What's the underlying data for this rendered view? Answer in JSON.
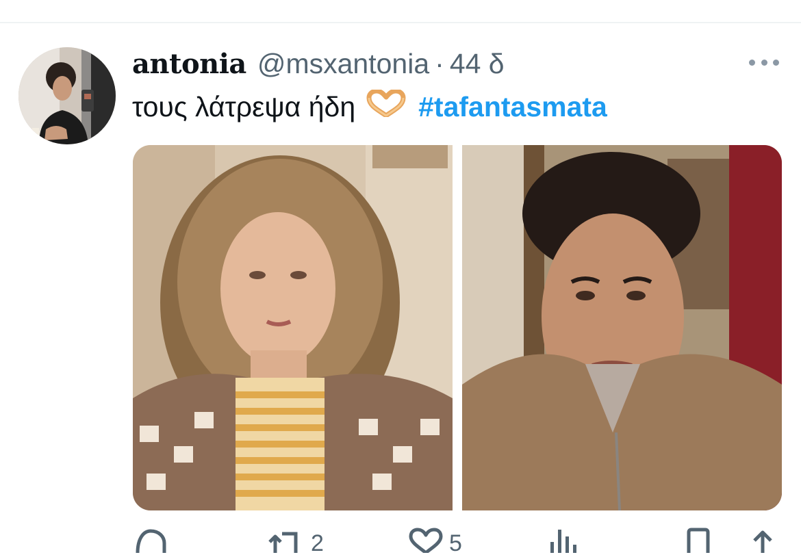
{
  "tweet": {
    "display_name": "antonia",
    "handle": "@msxantonia",
    "separator": "·",
    "time": "44 δ",
    "text": "τους λάτρεψα ήδη",
    "hashtag": "#tafantasmata"
  },
  "icons": {
    "emoji": "heart-hands-icon",
    "more": "more-icon",
    "reply": "reply-icon",
    "retweet": "retweet-icon",
    "like": "like-icon",
    "views": "views-icon",
    "bookmark": "bookmark-icon",
    "share": "share-icon"
  },
  "media": {
    "image_count": 2
  },
  "actions": {
    "retweet_count": "2",
    "like_count": "5"
  },
  "colors": {
    "text": "#0f1419",
    "secondary": "#536471",
    "link": "#1d9bf0"
  }
}
